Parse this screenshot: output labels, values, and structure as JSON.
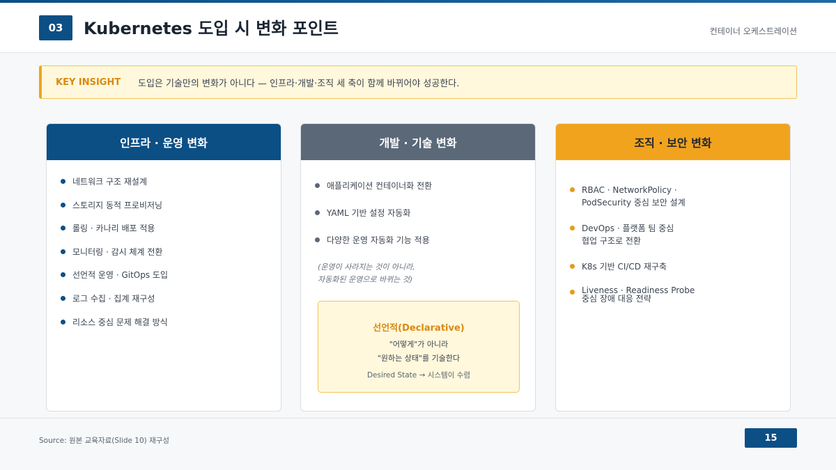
{
  "header": {
    "section_number": "03",
    "title": "Kubernetes 도입 시 변화 포인트",
    "subtitle": "컨테이너 오케스트레이션"
  },
  "insight": {
    "label": "KEY INSIGHT",
    "text": "도입은 기술만의 변화가 아니다 — 인프라·개발·조직 세 축이 함께 바뀌어야 성공한다."
  },
  "cards": [
    {
      "title": "인프라 · 운영 변화",
      "items": [
        "네트워크 구조 재설계",
        "스토리지 동적 프로비저닝",
        "롤링 · 카나리 배포 적용",
        "모니터링 · 감시 체계 전환",
        "선언적 운영 · GitOps 도입",
        "로그 수집 · 집계 재구성",
        "리소스 중심 문제 해결 방식"
      ]
    },
    {
      "title": "개발 · 기술 변화",
      "items": [
        "애플리케이션 컨테이너화 전환",
        "YAML 기반 설정 자동화",
        "다양한 운영 자동화 기능 적용"
      ],
      "note": "(운영이 사라지는 것이 아니라,\n자동화된 운영으로 바뀌는 것)",
      "concept": {
        "title": "선언적(Declarative)",
        "desc": "\"어떻게\"가 아니라\n\"원하는 상태\"를 기술한다",
        "foot": "Desired State → 시스템이 수렴"
      }
    },
    {
      "title": "조직 · 보안 변화",
      "items": [
        "RBAC · NetworkPolicy ·\nPodSecurity 중심 보안 설계",
        "DevOps · 플랫폼 팀 중심\n협업 구조로 전환",
        "K8s 기반 CI/CD 재구축",
        "Liveness · Readiness Probe\n중심 장애 대응 전략"
      ]
    }
  ],
  "footer": {
    "source": "Source: 원본 교육자료(Slide 10) 재구성",
    "page": "15"
  },
  "colors": {
    "primary": "#0b4f85",
    "secondary": "#5a6878",
    "accent": "#f2a31e",
    "insight_bg": "#fff8dc"
  }
}
